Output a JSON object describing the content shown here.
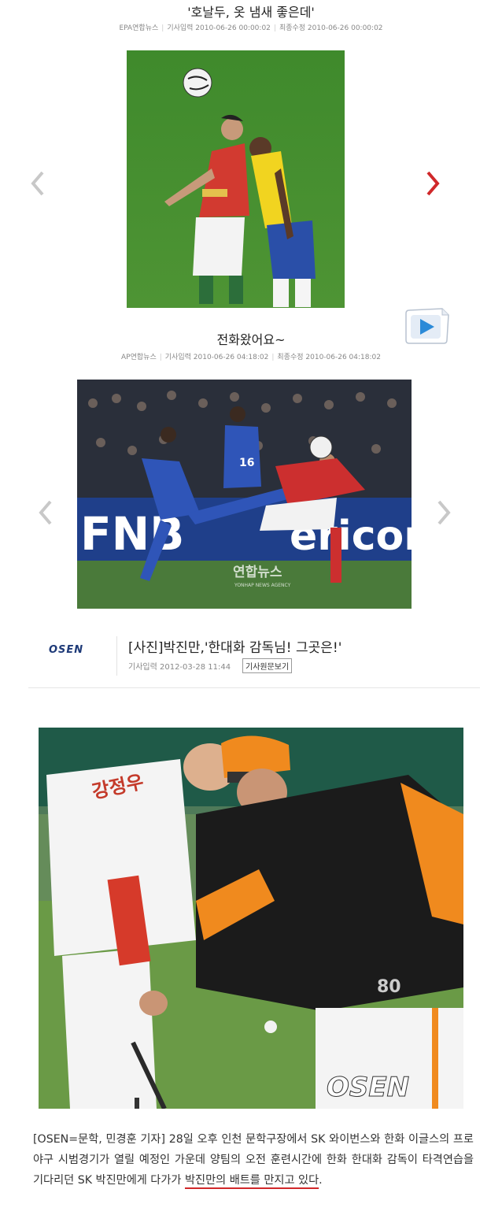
{
  "slide1": {
    "title": "'호날두, 옷 냄새 좋은데'",
    "source": "EPA연합뉴스",
    "posted": "기사입력 2010-06-26 00:00:02",
    "modified": "최종수정 2010-06-26 00:00:02"
  },
  "slide2": {
    "title": "전화왔어요~",
    "source": "AP연합뉴스",
    "posted": "기사입력 2010-06-26 04:18:02",
    "modified": "최종수정 2010-06-26 04:18:02",
    "ad_left": "FNB",
    "ad_right": "ericon",
    "watermark": "연합뉴스",
    "watermark_en": "YONHAP NEWS AGENCY",
    "jersey_number": "16"
  },
  "article": {
    "logo": "OSEN",
    "headline": "[사진]박진만,'한대화 감독님! 그곳은!'",
    "posted": "기사입력 2012-03-28 11:44",
    "original_button": "기사원문보기",
    "photo_watermark": "OSEN",
    "player_back": "강정우",
    "coach_number": "80",
    "caption_plain": "[OSEN=문학, 민경훈 기자] 28일 오후 인천 문학구장에서 SK 와이번스와 한화 이글스의 프로야구 시범경기가 열릴 예정인 가운데 양팀의 오전 훈련시간에 한화 한대화 감독이 타격연습을 기다리던 SK 박진만에게 다가가 ",
    "caption_highlight": "박진만의 배트를 만지고 있다",
    "caption_end": "."
  },
  "colors": {
    "arrow_active": "#d0282a",
    "arrow_inactive": "#c8c8c8",
    "highlight": "#d0282a",
    "osen_blue": "#1e3a78"
  },
  "icons": [
    "chevron-left-icon",
    "chevron-right-icon",
    "video-play-icon"
  ]
}
